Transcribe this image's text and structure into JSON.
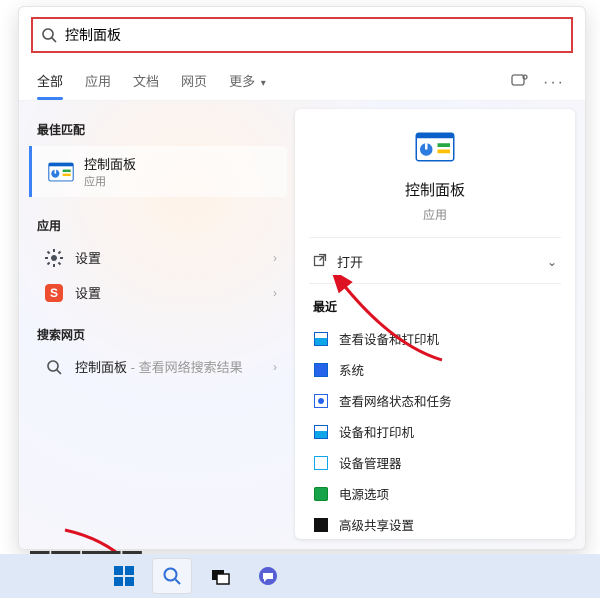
{
  "search": {
    "query": "控制面板"
  },
  "tabs": {
    "items": [
      "全部",
      "应用",
      "文档",
      "网页",
      "更多"
    ],
    "active_index": 0
  },
  "left": {
    "best_section": "最佳匹配",
    "best_match": {
      "title": "控制面板",
      "subtitle": "应用"
    },
    "apps_section": "应用",
    "apps": [
      {
        "label": "设置",
        "icon": "gear"
      },
      {
        "label": "设置",
        "icon": "sogou"
      }
    ],
    "web_section": "搜索网页",
    "web_item": {
      "prefix": "控制面板",
      "suffix": " - 查看网络搜索结果"
    }
  },
  "right": {
    "title": "控制面板",
    "subtitle": "应用",
    "open_label": "打开",
    "recent_label": "最近",
    "recent": [
      {
        "label": "查看设备和打印机",
        "color": "#0ea5e9"
      },
      {
        "label": "系统",
        "color": "#2563eb"
      },
      {
        "label": "查看网络状态和任务",
        "color": "#2563eb"
      },
      {
        "label": "设备和打印机",
        "color": "#0ea5e9"
      },
      {
        "label": "设备管理器",
        "color": "#0ea5e9"
      },
      {
        "label": "电源选项",
        "color": "#16a34a"
      },
      {
        "label": "高级共享设置",
        "color": "#111111"
      }
    ]
  }
}
